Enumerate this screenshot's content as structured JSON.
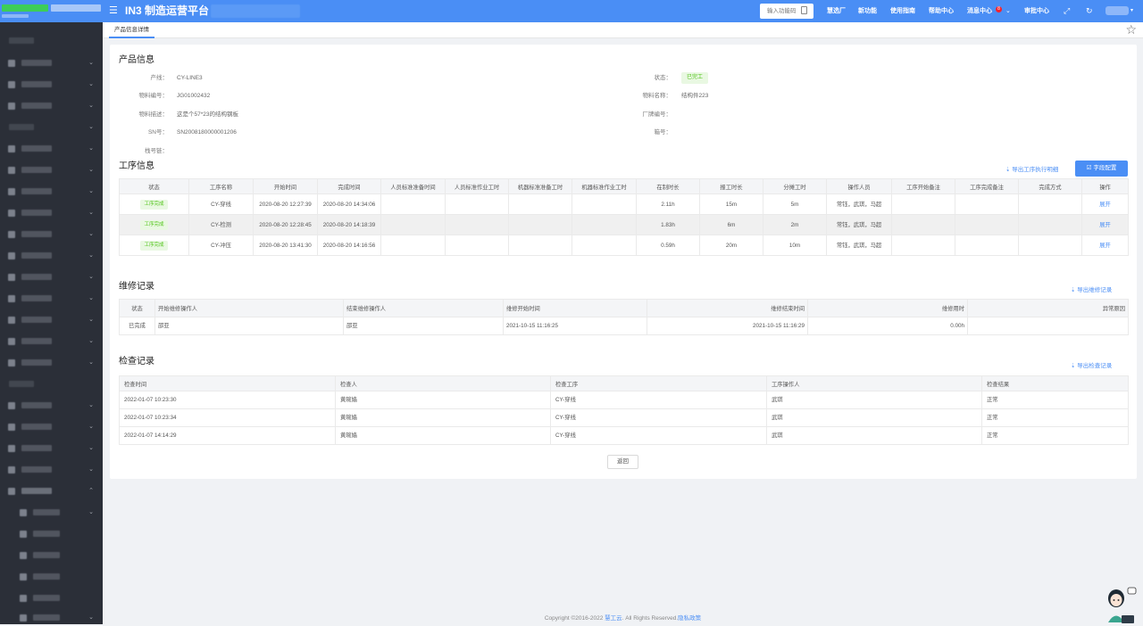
{
  "header": {
    "platform_title": "IN3 制造运营平台",
    "func_search_placeholder": "输入功能码",
    "nav": {
      "select_plant": "慧选厂",
      "new_feature": "新功能",
      "guide": "使用指南",
      "help": "帮助中心",
      "messages": "消息中心",
      "message_count": "8",
      "review": "审批中心"
    }
  },
  "tabs": [
    {
      "label": "产品信息详情"
    }
  ],
  "product_info": {
    "title": "产品信息",
    "line_label": "产线：",
    "line_value": "CY-LINE3",
    "status_label": "状态：",
    "status_value": "已完工",
    "material_no_label": "物料编号：",
    "material_no_value": "JG01002432",
    "material_name_label": "物料名称：",
    "material_name_value": "结构件223",
    "material_desc_label": "物料描述：",
    "material_desc_value": "这是个57*23的结构钢板",
    "vendor_no_label": "厂牌编号：",
    "sn_label": "SN号：",
    "sn_value": "SN2008180000001206",
    "box_no_label": "箱号：",
    "stack_no_label": "栈号链："
  },
  "process_info": {
    "title": "工序信息",
    "export_label": "导出工序执行明细",
    "config_label": "字段配置",
    "columns": [
      "状态",
      "工序名称",
      "开始时间",
      "完成时间",
      "人员标准准备时间",
      "人员标准作业工时",
      "机器标准准备工时",
      "机器标准作业工时",
      "在制时长",
      "报工时长",
      "分摊工时",
      "操作人员",
      "工序开始备注",
      "工序完成备注",
      "完成方式",
      "操作"
    ],
    "rows": [
      {
        "status": "工序完成",
        "name": "CY-穿线",
        "start": "2020-08-20 12:27:39",
        "end": "2020-08-20 14:34:06",
        "wip": "2.11h",
        "report": "15m",
        "share": "5m",
        "operators": "常钰，武琪，马超",
        "action": "展开"
      },
      {
        "status": "工序完成",
        "name": "CY-检测",
        "start": "2020-08-20 12:28:45",
        "end": "2020-08-20 14:18:39",
        "wip": "1.83h",
        "report": "6m",
        "share": "2m",
        "operators": "常钰，武琪，马超",
        "action": "展开"
      },
      {
        "status": "工序完成",
        "name": "CY-冲压",
        "start": "2020-08-20 13:41:30",
        "end": "2020-08-20 14:16:56",
        "wip": "0.59h",
        "report": "20m",
        "share": "10m",
        "operators": "常钰，武琪，马超",
        "action": "展开"
      }
    ]
  },
  "repair_record": {
    "title": "维修记录",
    "export_label": "导出维修记录",
    "columns": [
      "状态",
      "开始维修操作人",
      "结束维修操作人",
      "维修开始时间",
      "维修结束时间",
      "维修用时",
      "异常原因"
    ],
    "rows": [
      {
        "status": "已完成",
        "start_op": "邵亚",
        "end_op": "邵亚",
        "start_time": "2021-10-15 11:16:25",
        "end_time": "2021-10-15 11:16:29",
        "duration": "0.00h",
        "reason": ""
      }
    ]
  },
  "check_record": {
    "title": "检查记录",
    "export_label": "导出检查记录",
    "columns": [
      "检查时间",
      "检查人",
      "检查工序",
      "工序操作人",
      "检查结果"
    ],
    "rows": [
      {
        "time": "2022-01-07 10:23:30",
        "checker": "黄琬嫱",
        "process": "CY-穿线",
        "operator": "武琪",
        "result": "正常"
      },
      {
        "time": "2022-01-07 10:23:34",
        "checker": "黄琬嫱",
        "process": "CY-穿线",
        "operator": "武琪",
        "result": "正常"
      },
      {
        "time": "2022-01-07 14:14:29",
        "checker": "黄琬嫱",
        "process": "CY-穿线",
        "operator": "武琪",
        "result": "正常"
      }
    ]
  },
  "back_label": "返回",
  "footer": {
    "copyright": "Copyright ©2016-2022",
    "brand": "慧工云",
    "rights": ". All Rights Reserved.",
    "privacy": "隐私政策"
  },
  "colors": {
    "primary": "#4a8ef5",
    "sidebar": "#2b2f38",
    "success": "#52c41a"
  }
}
